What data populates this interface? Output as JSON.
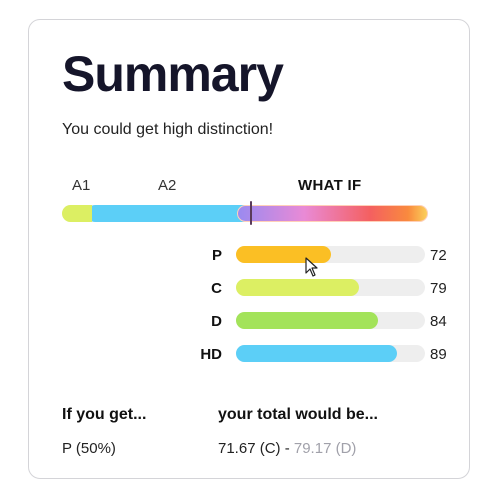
{
  "summary": {
    "title": "Summary",
    "subtitle": "You could get high distinction!"
  },
  "progress": {
    "segments": [
      {
        "label": "A1",
        "color": "#dcef63"
      },
      {
        "label": "A2",
        "color": "#5ccff7"
      },
      {
        "label": "WHAT IF",
        "colors": [
          "#9a8af0",
          "#e98ad6",
          "#f46060",
          "#fbd05a"
        ]
      }
    ]
  },
  "grades": [
    {
      "label": "P",
      "value": "72",
      "fill_fraction": 0.5,
      "color": "#fbbf24"
    },
    {
      "label": "C",
      "value": "79",
      "fill_fraction": 0.65,
      "color": "#dcef63"
    },
    {
      "label": "D",
      "value": "84",
      "fill_fraction": 0.75,
      "color": "#a3e35a"
    },
    {
      "label": "HD",
      "value": "89",
      "fill_fraction": 0.85,
      "color": "#5ccff7"
    }
  ],
  "results": {
    "col1_header": "If you get...",
    "col2_header": "your total would be...",
    "rows": [
      {
        "grade": "P (50%)",
        "total": "71.67 (C) -",
        "alt": "79.17 (D)"
      }
    ]
  }
}
